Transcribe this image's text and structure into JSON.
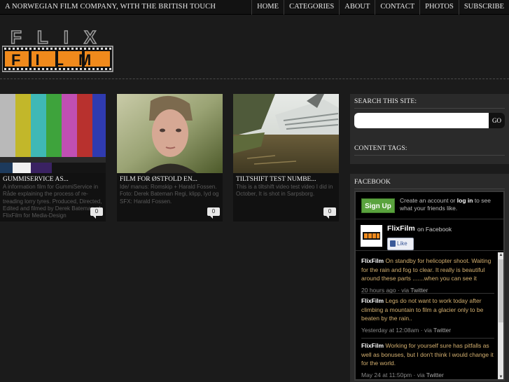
{
  "site": {
    "tagline": "A NORWEGIAN FILM COMPANY, WITH THE BRITISH TOUCH",
    "logo_text_top": "FLIX",
    "logo_text_bottom": "FILM"
  },
  "nav": {
    "items": [
      "HOME",
      "CATEGORIES",
      "ABOUT",
      "CONTACT",
      "PHOTOS",
      "SUBSCRIBE"
    ]
  },
  "posts": [
    {
      "title": "GUMMISERVICE AS...",
      "excerpt": "A information film for GummiService in Råde explaining the process of re-treading lorry tyres. Produced, Directed, Edited and filmed by Derek Bateman of FlixFilm for Media-Design",
      "comments": "0"
    },
    {
      "title": "FILM FOR ØSTFOLD EN...",
      "excerpt": "Ide/ manus: Romskip + Harald Fossen. Foto: Derek Bateman Regi, klipp, lyd og SFX: Harald Fossen.",
      "comments": "0"
    },
    {
      "title": "TILTSHIFT TEST NUMBE...",
      "excerpt": "This is a tiltshift video test video I did in October, It is shot in Sarpsborg.",
      "comments": "0"
    }
  ],
  "sidebar": {
    "search_title": "SEARCH THIS SITE:",
    "search_placeholder": "",
    "search_button": "GO",
    "tags_title": "CONTENT TAGS:",
    "facebook_title": "FACEBOOK"
  },
  "facebook": {
    "signup": "Sign Up",
    "cta_pre": "Create an account or",
    "cta_login": "log in",
    "cta_post": "to see what your friends like.",
    "page_name": "FlixFilm",
    "on_facebook": "on Facebook",
    "like": "Like",
    "posts": [
      {
        "author": "FlixFilm",
        "text": "On standby for helicopter shoot. Waiting for the rain and fog to clear. It really is beautiful around these parts .......when you can see it",
        "time": "20 hours ago",
        "via": "Twitter"
      },
      {
        "author": "FlixFilm",
        "text": "Legs do not want to work today after climbing a mountain to film a glacier only to be beaten by the rain..",
        "time": "Yesterday at 12:08am",
        "via": "Twitter"
      },
      {
        "author": "FlixFilm",
        "text": "Working for yourself sure has pitfalls as well as bonuses, but I don't think I would change it for the world.",
        "time": "May 24 at 11:50pm",
        "via": "Twitter"
      }
    ],
    "via_prefix": "· via"
  },
  "colors": {
    "background": "#1b1b1b",
    "logo_orange": "#f08a1c",
    "fb_green": "#5aa33e"
  }
}
